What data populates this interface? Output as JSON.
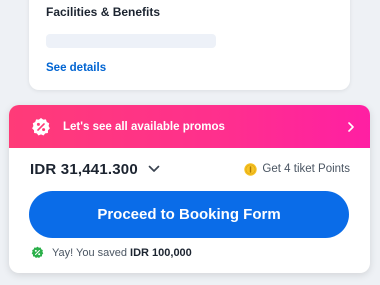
{
  "facilities": {
    "title": "Facilities & Benefits",
    "see_details_label": "See details"
  },
  "promo": {
    "label": "Let's see all available promos",
    "icon": "discount-badge-icon",
    "chevron_icon": "chevron-right-icon"
  },
  "price": {
    "value": "IDR 31,441.300",
    "chevron_icon": "chevron-down-icon"
  },
  "points": {
    "label": "Get 4 tiket Points",
    "icon": "coin-icon"
  },
  "cta": {
    "label": "Proceed to Booking Form"
  },
  "savings": {
    "prefix": "Yay! You saved",
    "amount": "IDR 100,000",
    "icon": "discount-badge-icon"
  },
  "colors": {
    "promo_gradient_start": "#ff3b78",
    "promo_gradient_end": "#ff1fa3",
    "primary_blue": "#0a6ce8",
    "link_blue": "#0064d2",
    "savings_green": "#2bb04a",
    "coin_yellow": "#f7c325"
  }
}
